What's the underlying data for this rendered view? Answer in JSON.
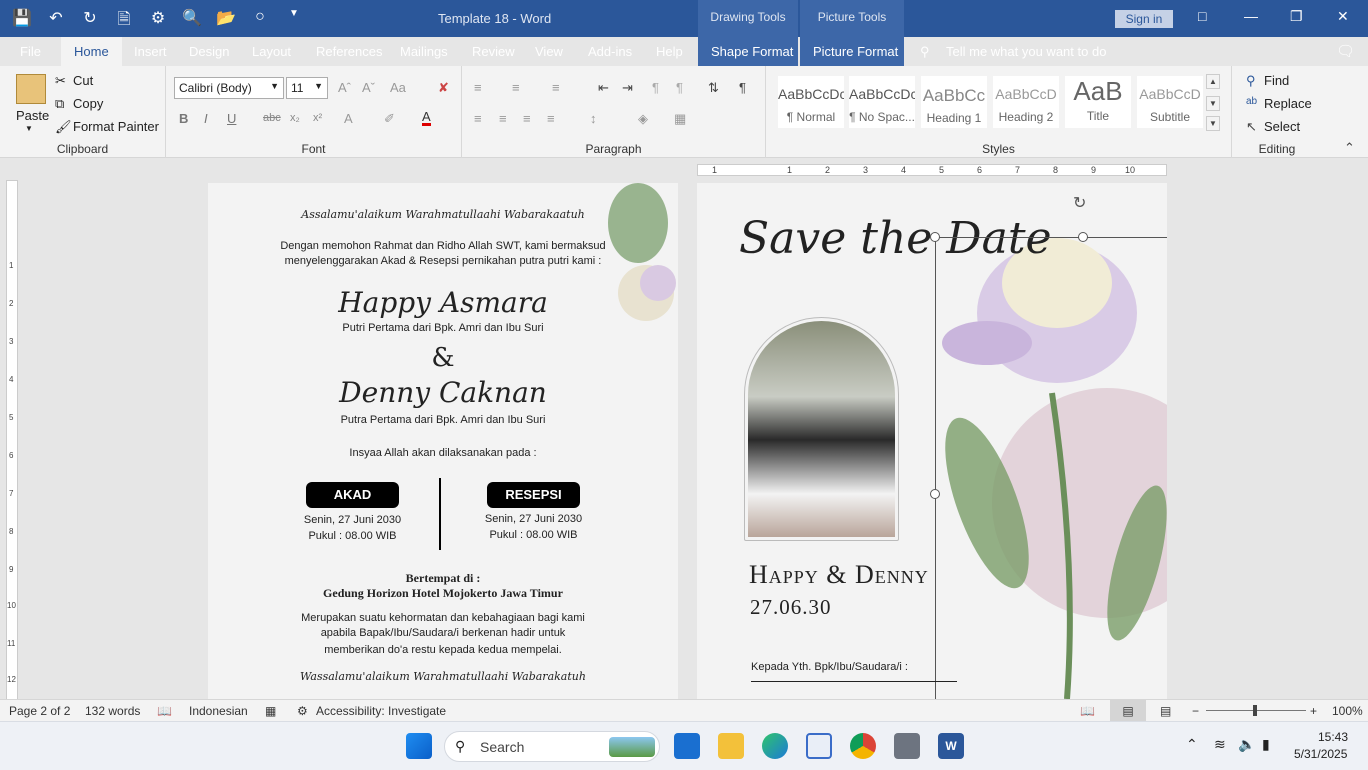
{
  "window": {
    "title": "Template 18  -  Word",
    "sign_in": "Sign in"
  },
  "context_tabs": {
    "drawing_tools": "Drawing Tools",
    "picture_tools": "Picture Tools"
  },
  "tabs": [
    "File",
    "Home",
    "Insert",
    "Design",
    "Layout",
    "References",
    "Mailings",
    "Review",
    "View",
    "Add-ins",
    "Help",
    "Shape Format",
    "Picture Format"
  ],
  "tell_me": "Tell me what you want to do",
  "clipboard": {
    "paste": "Paste",
    "cut": "Cut",
    "copy": "Copy",
    "format_painter": "Format Painter",
    "label": "Clipboard"
  },
  "font": {
    "name": "Calibri (Body)",
    "size": "11",
    "label": "Font"
  },
  "paragraph": {
    "label": "Paragraph"
  },
  "styles": {
    "items": [
      {
        "preview": "AaBbCcDc",
        "name": "¶ Normal"
      },
      {
        "preview": "AaBbCcDc",
        "name": "¶ No Spac..."
      },
      {
        "preview": "AaBbCc",
        "name": "Heading 1"
      },
      {
        "preview": "AaBbCcD",
        "name": "Heading 2"
      },
      {
        "preview": "AaB",
        "name": "Title"
      },
      {
        "preview": "AaBbCcD",
        "name": "Subtitle"
      }
    ],
    "label": "Styles"
  },
  "editing": {
    "find": "Find",
    "replace": "Replace",
    "select": "Select",
    "label": "Editing"
  },
  "page1": {
    "greeting": "Assalamu'alaikum Warahmatullaahi Wabarakaatuh",
    "intro_1": "Dengan memohon Rahmat dan Ridho Allah SWT, kami bermaksud",
    "intro_2": "menyelenggarakan Akad & Resepsi pernikahan putra putri kami :",
    "bride": "Happy Asmara",
    "bride_parents": "Putri Pertama dari Bpk. Amri dan Ibu Suri",
    "amp": "&",
    "groom": "Denny Caknan",
    "groom_parents": "Putra Pertama dari Bpk. Amri dan Ibu Suri",
    "insyaa": "Insyaa Allah akan dilaksanakan pada :",
    "akad": {
      "label": "AKAD",
      "date": "Senin, 27 Juni 2030",
      "time": "Pukul : 08.00 WIB"
    },
    "resepsi": {
      "label": "RESEPSI",
      "date": "Senin, 27 Juni 2030",
      "time": "Pukul : 08.00 WIB"
    },
    "venue_label": "Bertempat di :",
    "venue": "Gedung Horizon Hotel Mojokerto Jawa Timur",
    "closing_1": "Merupakan suatu kehormatan dan kebahagiaan bagi kami",
    "closing_2": "apabila Bapak/Ibu/Saudara/i berkenan hadir untuk",
    "closing_3": "memberikan do'a restu kepada kedua mempelai.",
    "farewell": "Wassalamu'alaikum Warahmatullaahi Wabarakatuh"
  },
  "page2": {
    "save_the_date": "Save the Date",
    "names": "Happy & Denny",
    "date": "27.06.30",
    "to": "Kepada Yth. Bpk/Ibu/Saudara/i :"
  },
  "status": {
    "page": "Page 2 of 2",
    "words": "132 words",
    "language": "Indonesian",
    "accessibility": "Accessibility: Investigate",
    "zoom": "100%"
  },
  "taskbar": {
    "search": "Search",
    "time": "15:43",
    "date": "5/31/2025"
  },
  "ruler": {
    "h": [
      "1",
      "1",
      "2",
      "3",
      "4",
      "5",
      "6",
      "7",
      "8",
      "9",
      "10"
    ],
    "v": [
      "1",
      "2",
      "3",
      "4",
      "5",
      "6",
      "7",
      "8",
      "9",
      "10",
      "11",
      "12"
    ]
  }
}
